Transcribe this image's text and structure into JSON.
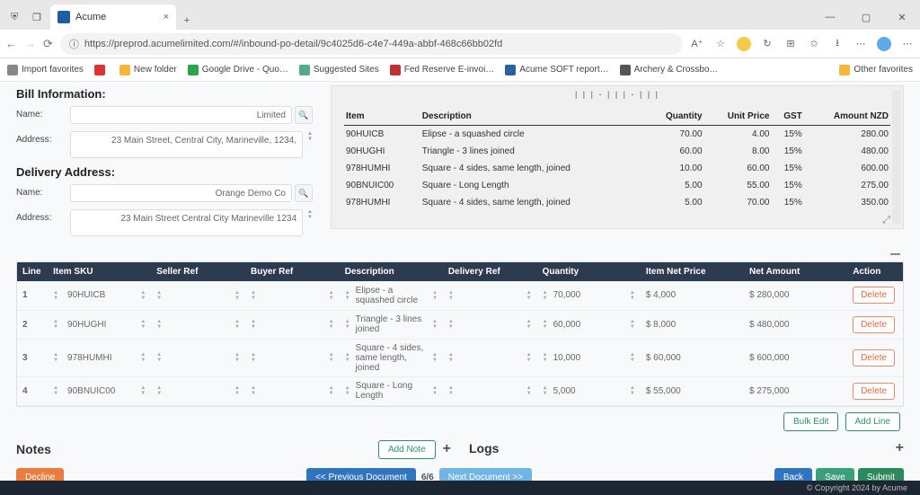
{
  "browser": {
    "tab_title": "Acume",
    "url": "https://preprod.acumelimited.com/#/inbound-po-detail/9c4025d6-c4e7-449a-abbf-468c66bb02fd",
    "bookmarks": [
      "Import favorites",
      "",
      "New folder",
      "Google Drive - Quo…",
      "Suggested Sites",
      "Fed Reserve E-invoi…",
      "Acume SOFT report…",
      "Archery & Crossbo…"
    ],
    "other_fav": "Other favorites"
  },
  "bill_info": {
    "title": "Bill Information:",
    "name_label": "Name:",
    "name_value": "Limited",
    "address_label": "Address:",
    "address_value": "23 Main Street, Central City, Marineville, 1234,"
  },
  "delivery": {
    "title": "Delivery Address:",
    "name_label": "Name:",
    "name_value": "Orange Demo Co",
    "address_label": "Address:",
    "address_value": "23 Main Street Central City Marineville 1234"
  },
  "chart_data": {
    "type": "table",
    "title": "",
    "columns": [
      "Item",
      "Description",
      "Quantity",
      "Unit Price",
      "GST",
      "Amount NZD"
    ],
    "rows": [
      [
        "90HUICB",
        "Elipse - a squashed circle",
        "70.00",
        "4.00",
        "15%",
        "280.00"
      ],
      [
        "90HUGHI",
        "Triangle - 3 lines joined",
        "60.00",
        "8.00",
        "15%",
        "480.00"
      ],
      [
        "978HUMHI",
        "Square - 4 sides, same length, joined",
        "10.00",
        "60.00",
        "15%",
        "600.00"
      ],
      [
        "90BNUIC00",
        "Square - Long Length",
        "5.00",
        "55.00",
        "15%",
        "275.00"
      ],
      [
        "978HUMHI",
        "Square - 4 sides, same length, joined",
        "5.00",
        "70.00",
        "15%",
        "350.00"
      ]
    ],
    "barcode": "| | | - | | | - | | |"
  },
  "grid": {
    "headers": {
      "line": "Line",
      "sku": "Item SKU",
      "seller": "Seller Ref",
      "buyer": "Buyer Ref",
      "desc": "Description",
      "delivery": "Delivery Ref",
      "qty": "Quantity",
      "net": "Item Net Price",
      "amount": "Net Amount",
      "action": "Action"
    },
    "rows": [
      {
        "line": "1",
        "sku": "90HUICB",
        "desc": "Elipse - a squashed circle",
        "qty": "70,000",
        "net": "$  4,000",
        "amount": "$  280,000"
      },
      {
        "line": "2",
        "sku": "90HUGHI",
        "desc": "Triangle - 3 lines joined",
        "qty": "60,000",
        "net": "$  8,000",
        "amount": "$  480,000"
      },
      {
        "line": "3",
        "sku": "978HUMHI",
        "desc": "Square - 4 sides, same length, joined",
        "qty": "10,000",
        "net": "$  60,000",
        "amount": "$  600,000"
      },
      {
        "line": "4",
        "sku": "90BNUIC00",
        "desc": "Square - Long Length",
        "qty": "5,000",
        "net": "$  55,000",
        "amount": "$  275,000"
      }
    ],
    "delete_label": "Delete",
    "bulk_edit": "Bulk Edit",
    "add_line": "Add Line"
  },
  "notes": {
    "title": "Notes",
    "add": "Add Note"
  },
  "logs": {
    "title": "Logs"
  },
  "actions": {
    "decline": "Decline",
    "prev": "<< Previous Document",
    "page": "6/6",
    "next": "Next Document >>",
    "back": "Back",
    "save": "Save",
    "submit": "Submit"
  },
  "footer": "© Copyright 2024 by Acume"
}
